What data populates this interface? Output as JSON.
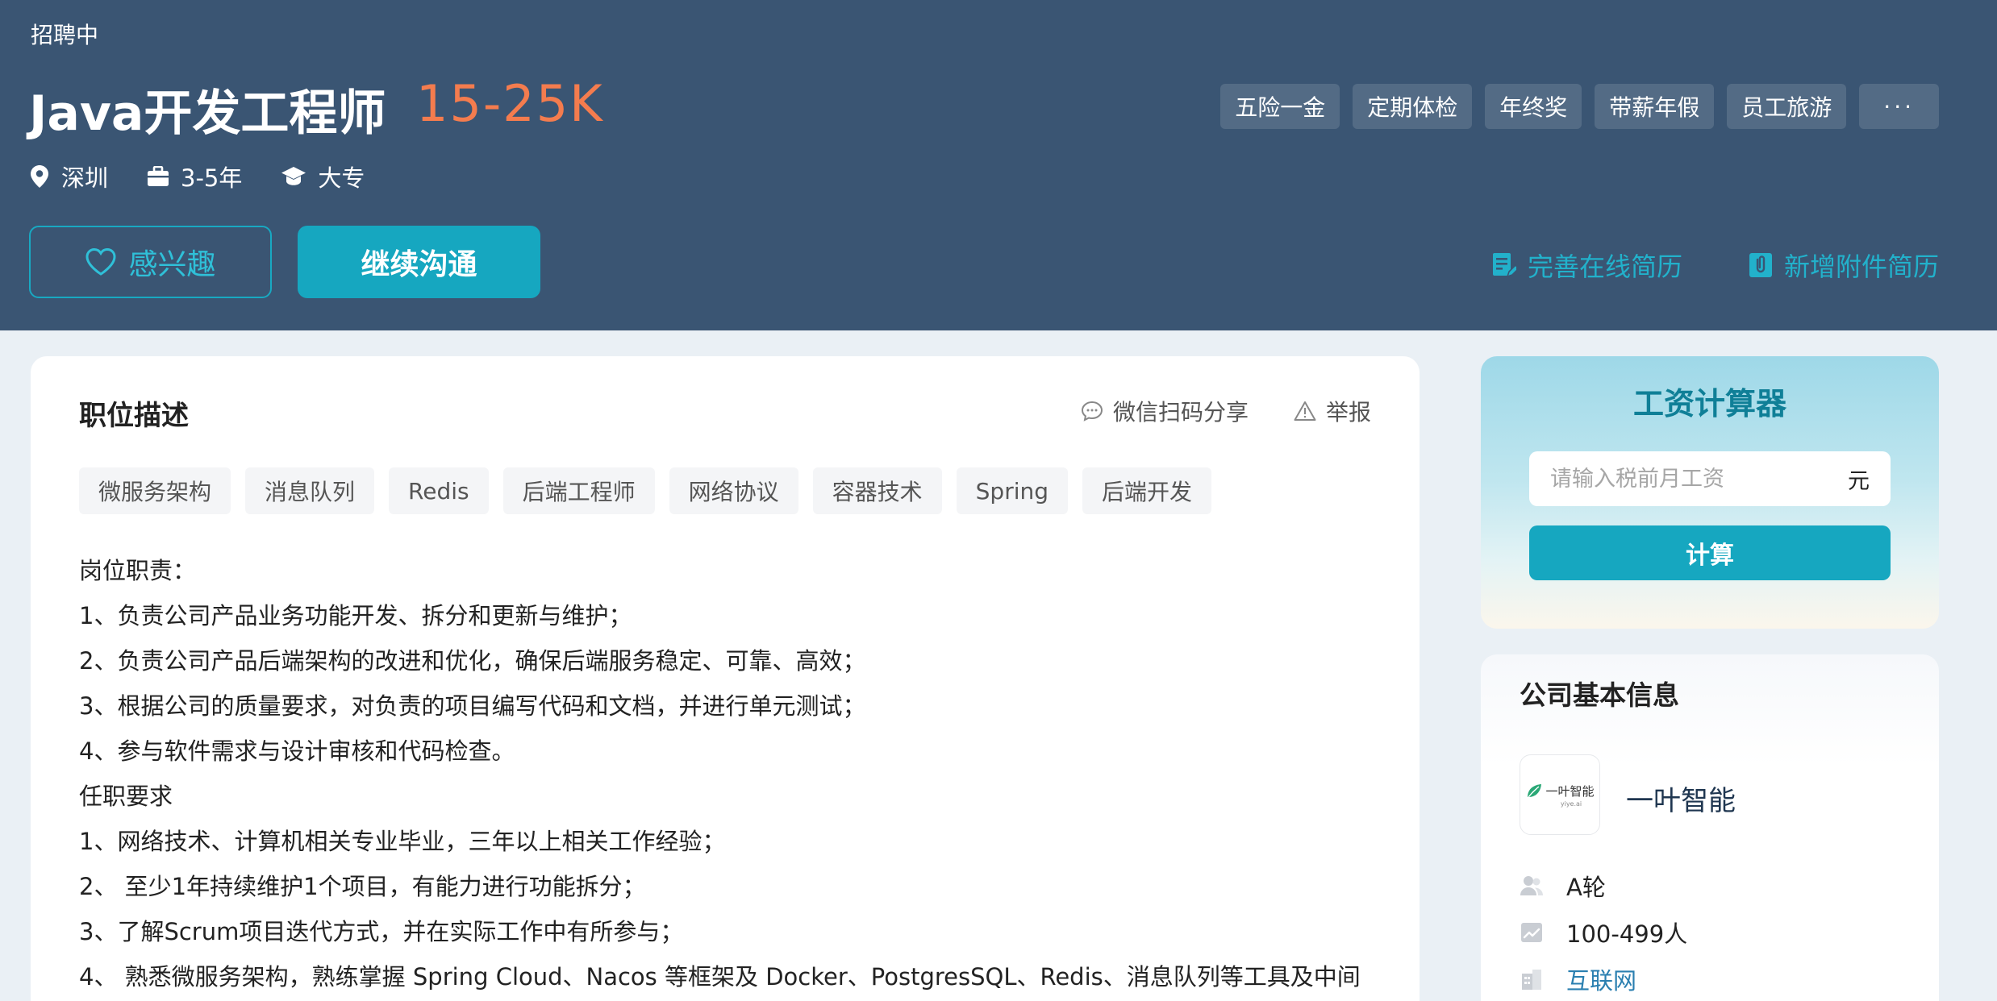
{
  "header": {
    "status": "招聘中",
    "job_title": "Java开发工程师",
    "salary": "15-25K",
    "meta": {
      "city": "深圳",
      "experience": "3-5年",
      "education": "大专"
    },
    "benefits": [
      "五险一金",
      "定期体检",
      "年终奖",
      "带薪年假",
      "员工旅游"
    ],
    "more_label": "···",
    "interest_label": "感兴趣",
    "chat_label": "继续沟通",
    "complete_resume_label": "完善在线简历",
    "add_attachment_label": "新增附件简历"
  },
  "description": {
    "title": "职位描述",
    "share_label": "微信扫码分享",
    "report_label": "举报",
    "tags": [
      "微服务架构",
      "消息队列",
      "Redis",
      "后端工程师",
      "网络协议",
      "容器技术",
      "Spring",
      "后端开发"
    ],
    "lines": [
      "岗位职责：",
      "1、负责公司产品业务功能开发、拆分和更新与维护；",
      "2、负责公司产品后端架构的改进和优化，确保后端服务稳定、可靠、高效；",
      "3、根据公司的质量要求，对负责的项目编写代码和文档，并进行单元测试；",
      "4、参与软件需求与设计审核和代码检查。",
      "任职要求",
      "1、网络技术、计算机相关专业毕业，三年以上相关工作经验；",
      "2、 至少1年持续维护1个项目，有能力进行功能拆分；",
      "3、了解Scrum项目迭代方式，并在实际工作中有所参与；",
      "4、 熟悉微服务架构，熟练掌握 Spring Cloud、Nacos 等框架及 Docker、PostgresSQL、Redis、消息队列等工具及中间"
    ]
  },
  "calculator": {
    "title": "工资计算器",
    "placeholder": "请输入税前月工资",
    "unit": "元",
    "button_label": "计算"
  },
  "company": {
    "title": "公司基本信息",
    "logo_text": "一叶智能",
    "logo_sub": "yiye.ai",
    "name": "一叶智能",
    "funding": "A轮",
    "size": "100-499人",
    "industry": "互联网"
  },
  "colors": {
    "header_bg": "#3a5573",
    "salary": "#f47c4e",
    "accent": "#16a7c0",
    "link": "#22b1cb"
  }
}
